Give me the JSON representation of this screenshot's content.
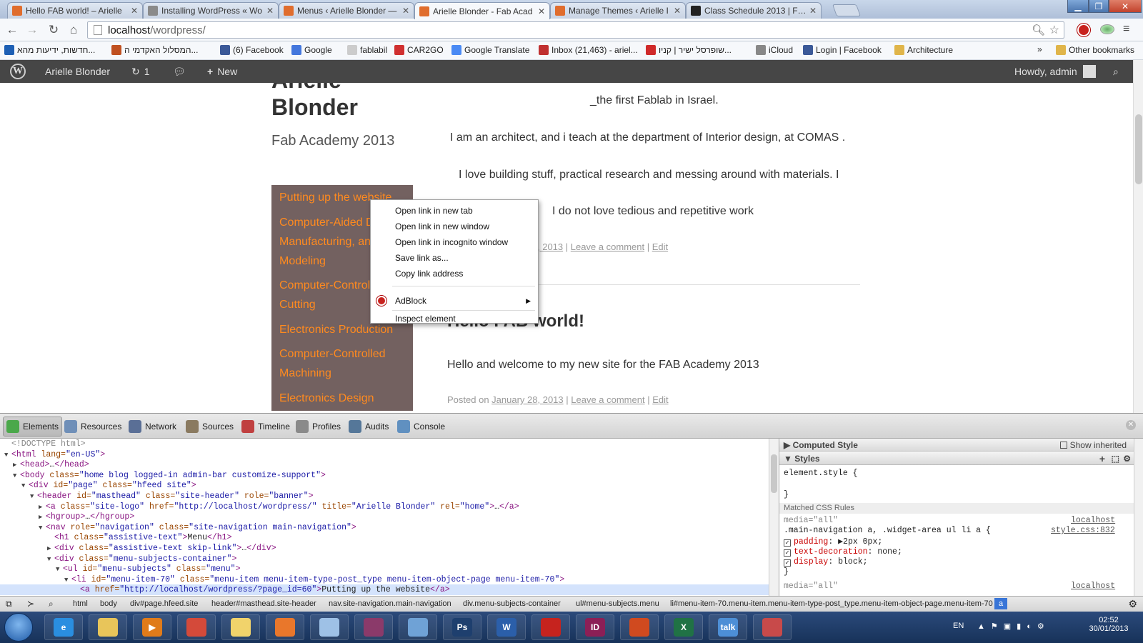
{
  "browser": {
    "tabs": [
      {
        "title": "Hello FAB world! – Arielle",
        "fav_color": "#e06d2d",
        "active": false
      },
      {
        "title": "Installing WordPress « Wo",
        "fav_color": "#8a8a8a",
        "active": false
      },
      {
        "title": "Menus ‹ Arielle Blonder —",
        "fav_color": "#e06d2d",
        "active": false
      },
      {
        "title": "Arielle Blonder - Fab Acad",
        "fav_color": "#e06d2d",
        "active": true
      },
      {
        "title": "Manage Themes ‹ Arielle I",
        "fav_color": "#e06d2d",
        "active": false
      },
      {
        "title": "Class Schedule 2013 | Fab",
        "fav_color": "#222222",
        "active": false
      }
    ],
    "url_host": "localhost",
    "url_path": "/wordpress/",
    "bookmarks": [
      {
        "label": "חדשות, ידיעות מהא...",
        "icon_color": "#1d5fb4"
      },
      {
        "label": "המסלול האקדמי ה...",
        "icon_color": "#c05020"
      },
      {
        "label": "(6) Facebook",
        "icon_color": "#3b5998"
      },
      {
        "label": "Google",
        "icon_color": "#4477dd"
      },
      {
        "label": "fablabil",
        "icon_color": "#cccccc"
      },
      {
        "label": "CAR2GO",
        "icon_color": "#d03030"
      },
      {
        "label": "Google Translate",
        "icon_color": "#4a8af4"
      },
      {
        "label": "Inbox (21,463) - ariel...",
        "icon_color": "#c03030"
      },
      {
        "label": "שופרסל ישיר | קניו...",
        "icon_color": "#d02a2a"
      },
      {
        "label": "iCloud",
        "icon_color": "#888888"
      },
      {
        "label": "Login | Facebook",
        "icon_color": "#3b5998"
      },
      {
        "label": "Architecture",
        "icon_color": "#e0b54a"
      }
    ],
    "overflow_label": "»",
    "other_bookmarks": "Other bookmarks"
  },
  "adminbar": {
    "site_name": "Arielle Blonder",
    "updates_count": "1",
    "new_label": "New",
    "howdy": "Howdy, admin"
  },
  "site": {
    "title_line1": "Arielle",
    "title_line2": "Blonder",
    "description": "Fab Academy 2013",
    "menu": [
      "Putting up the website",
      "Computer-Aided Design, Manufacturing, and Modeling",
      "Computer-Controlled Cutting",
      "Electronics Production",
      "Computer-Controlled Machining",
      "Electronics Design"
    ],
    "post1": {
      "lines": [
        "_the first Fablab in Israel.",
        "I am an architect, and i teach at the department of Interior design, at COMAS .",
        "I love building stuff, practical research and messing around with materials. I",
        "I do not love tedious and repetitive work"
      ],
      "date_fragment": ", 2013",
      "leave_comment": "Leave a comment",
      "edit": "Edit"
    },
    "post2": {
      "title": "Hello FAB world!",
      "body": "Hello and welcome to my new site for the FAB Academy 2013",
      "posted_on": "Posted on",
      "date": "January 28, 2013",
      "leave_comment": "Leave a comment",
      "edit": "Edit"
    }
  },
  "context_menu": {
    "items": [
      "Open link in new tab",
      "Open link in new window",
      "Open link in incognito window",
      "Save link as...",
      "Copy link address"
    ],
    "adblock": "AdBlock",
    "inspect": "Inspect element"
  },
  "devtools": {
    "tabs": [
      "Elements",
      "Resources",
      "Network",
      "Sources",
      "Timeline",
      "Profiles",
      "Audits",
      "Console"
    ],
    "dom": [
      {
        "indent": 0,
        "tri": "",
        "html": "<!DOCTYPE html>"
      },
      {
        "indent": 0,
        "tri": "▼",
        "html": "<html lang=\"en-US\">"
      },
      {
        "indent": 1,
        "tri": "▶",
        "html": "<head>…</head>"
      },
      {
        "indent": 1,
        "tri": "▼",
        "html": "<body class=\"home blog logged-in admin-bar  customize-support\">"
      },
      {
        "indent": 2,
        "tri": "▼",
        "html": "<div id=\"page\" class=\"hfeed site\">"
      },
      {
        "indent": 3,
        "tri": "▼",
        "html": "<header id=\"masthead\" class=\"site-header\" role=\"banner\">"
      },
      {
        "indent": 4,
        "tri": "▶",
        "html": "<a class=\"site-logo\" href=\"http://localhost/wordpress/\" title=\"Arielle Blonder\" rel=\"home\">…</a>"
      },
      {
        "indent": 4,
        "tri": "▶",
        "html": "<hgroup>…</hgroup>"
      },
      {
        "indent": 4,
        "tri": "▼",
        "html": "<nav role=\"navigation\" class=\"site-navigation main-navigation\">"
      },
      {
        "indent": 5,
        "tri": "",
        "html": "<h1 class=\"assistive-text\">Menu</h1>"
      },
      {
        "indent": 5,
        "tri": "▶",
        "html": "<div class=\"assistive-text skip-link\">…</div>"
      },
      {
        "indent": 5,
        "tri": "▼",
        "html": "<div class=\"menu-subjects-container\">"
      },
      {
        "indent": 6,
        "tri": "▼",
        "html": "<ul id=\"menu-subjects\" class=\"menu\">"
      },
      {
        "indent": 7,
        "tri": "▼",
        "html": "<li id=\"menu-item-70\" class=\"menu-item menu-item-type-post_type menu-item-object-page menu-item-70\">"
      },
      {
        "indent": 8,
        "tri": "",
        "html": "<a href=\"http://localhost/wordpress/?page_id=60\">Putting up the website</a>"
      }
    ],
    "styles": {
      "computed_label": "Computed Style",
      "show_inherited": "Show inherited",
      "styles_label": "Styles",
      "element_style": "element.style {",
      "close_brace": "}",
      "matched_label": "Matched CSS Rules",
      "media": "media=\"all\"",
      "source_host": "localhost",
      "source_file": "style.css:832",
      "selector": ".main-navigation a, .widget-area ul li a {",
      "props": [
        {
          "name": "padding",
          "value": "▶2px 0px;"
        },
        {
          "name": "text-decoration",
          "value": "none;"
        },
        {
          "name": "display",
          "value": "block;"
        }
      ],
      "media2": "media=\"all\"",
      "source_host2": "localhost"
    },
    "breadcrumbs": [
      "html",
      "body",
      "div#page.hfeed.site",
      "header#masthead.site-header",
      "nav.site-navigation.main-navigation",
      "div.menu-subjects-container",
      "ul#menu-subjects.menu",
      "li#menu-item-70.menu-item.menu-item-type-post_type.menu-item-object-page.menu-item-70",
      "a"
    ]
  },
  "taskbar": {
    "lang": "EN",
    "time": "02:52",
    "date": "30/01/2013",
    "apps": [
      {
        "name": "ie",
        "color": "#2a8ee0",
        "glyph": "e"
      },
      {
        "name": "explorer",
        "color": "#e8c55a",
        "glyph": ""
      },
      {
        "name": "media-player",
        "color": "#e07b1a",
        "glyph": "▶"
      },
      {
        "name": "chrome",
        "color": "#d44a3a",
        "glyph": ""
      },
      {
        "name": "outlook",
        "color": "#f1d36b",
        "glyph": ""
      },
      {
        "name": "app-orange",
        "color": "#e9772b",
        "glyph": ""
      },
      {
        "name": "notes",
        "color": "#9ec1e6",
        "glyph": ""
      },
      {
        "name": "winrar",
        "color": "#8b3a6a",
        "glyph": ""
      },
      {
        "name": "screen",
        "color": "#6fa2d6",
        "glyph": ""
      },
      {
        "name": "photoshop",
        "color": "#1e3f6e",
        "glyph": "Ps"
      },
      {
        "name": "word",
        "color": "#2b5faa",
        "glyph": "W"
      },
      {
        "name": "acrobat",
        "color": "#c6231e",
        "glyph": ""
      },
      {
        "name": "indesign",
        "color": "#8c1f56",
        "glyph": "ID"
      },
      {
        "name": "powerpoint",
        "color": "#d04a1f",
        "glyph": ""
      },
      {
        "name": "excel",
        "color": "#207245",
        "glyph": "X"
      },
      {
        "name": "gtalk",
        "color": "#4d8fd6",
        "glyph": "talk"
      },
      {
        "name": "snipping",
        "color": "#c84a4a",
        "glyph": ""
      }
    ]
  }
}
